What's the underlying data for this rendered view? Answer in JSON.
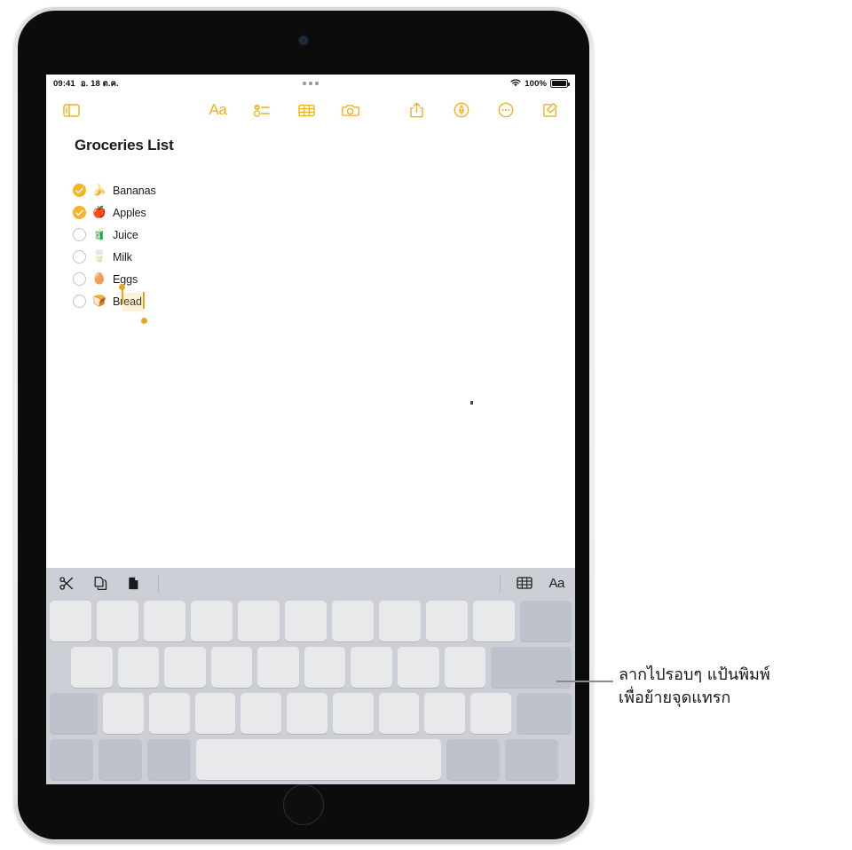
{
  "device": {
    "name": "iPad",
    "camera_icon": "front-camera",
    "home_button_icon": "home-button"
  },
  "status_bar": {
    "time": "09:41",
    "date": "อ. 18 ต.ค.",
    "multitask_indicator": "multitasking-dots",
    "wifi_icon": "wifi-icon",
    "battery_percent": "100%",
    "battery_icon": "battery-full-icon"
  },
  "toolbar": {
    "sidebar_icon": "sidebar-icon",
    "format_label": "Aa",
    "format_icon": "format-aa-icon",
    "checklist_icon": "checklist-icon",
    "table_icon": "table-icon",
    "camera_icon": "camera-icon",
    "share_icon": "share-icon",
    "markup_icon": "markup-pen-icon",
    "more_icon": "more-ellipsis-icon",
    "compose_icon": "compose-icon",
    "accent_color": "#f0ad1e"
  },
  "note": {
    "title": "Groceries List",
    "items": [
      {
        "label": "Bananas",
        "emoji": "🍌",
        "checked": true
      },
      {
        "label": "Apples",
        "emoji": "🍎",
        "checked": true
      },
      {
        "label": "Juice",
        "emoji": "🧃",
        "checked": false
      },
      {
        "label": "Milk",
        "emoji": "🥛",
        "checked": false
      },
      {
        "label": "Eggs",
        "emoji": "🥚",
        "checked": false
      },
      {
        "label": "Bread",
        "emoji": "🍞",
        "checked": false
      }
    ],
    "selection": {
      "on_item": "Bread",
      "selected_text": "read",
      "handle_color": "#e8a81c"
    }
  },
  "keyboard": {
    "shortcut_bar": {
      "cut_icon": "cut-scissors-icon",
      "copy_icon": "copy-icon",
      "paste_icon": "paste-icon",
      "table_icon": "table-icon",
      "format_label": "Aa",
      "format_icon": "format-aa-icon"
    },
    "mode": "trackpad-blank-keys",
    "rows": [
      {
        "keys": 10,
        "mod_tail": 1
      },
      {
        "keys": 9,
        "return": true
      },
      {
        "keys": 10,
        "shift_left": true,
        "shift_right": true
      },
      {
        "spacebar": true
      }
    ]
  },
  "callout": {
    "line1": "ลากไปรอบๆ แป้นพิมพ์",
    "line2": "เพื่อย้ายจุดแทรก",
    "leader_color": "#8a8a8d"
  }
}
